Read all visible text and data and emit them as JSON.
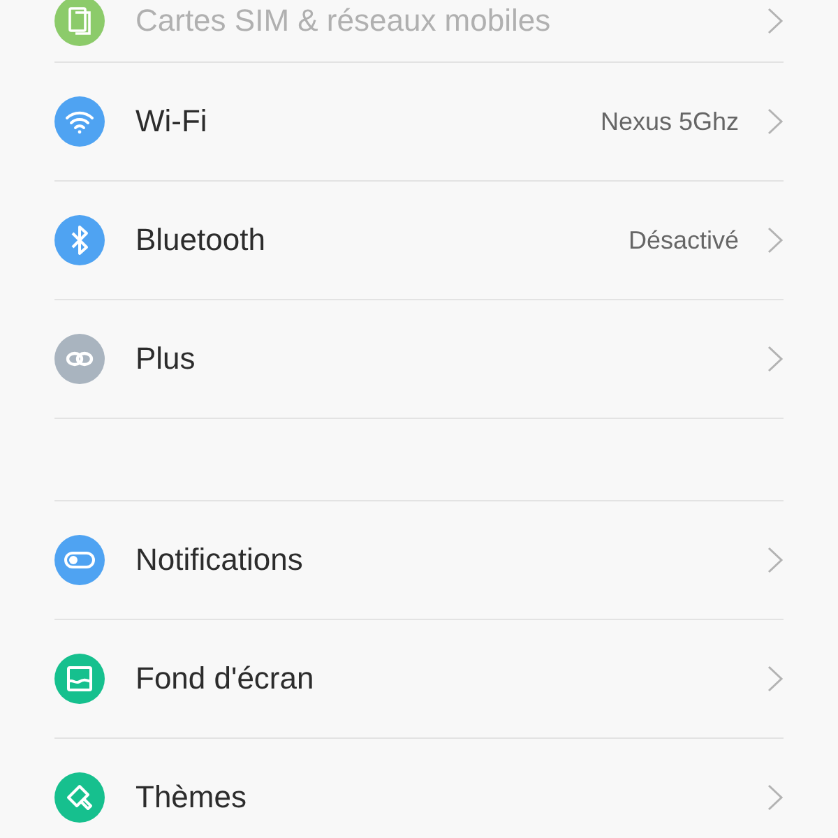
{
  "sections": [
    {
      "items": [
        {
          "color": "#8ccb6a",
          "label": "Cartes SIM & réseaux mobiles",
          "disabled": true
        },
        {
          "color": "#4fa3f2",
          "label": "Wi-Fi",
          "value": "Nexus 5Ghz",
          "disabled": false
        },
        {
          "color": "#4fa3f2",
          "label": "Bluetooth",
          "value": "Désactivé",
          "disabled": false
        },
        {
          "color": "#a9b4bf",
          "label": "Plus",
          "disabled": false
        }
      ]
    },
    {
      "items": [
        {
          "color": "#4fa3f2",
          "label": "Notifications",
          "disabled": false
        },
        {
          "color": "#16c08e",
          "label": "Fond d'écran",
          "disabled": false
        },
        {
          "color": "#16c08e",
          "label": "Thèmes",
          "disabled": false
        }
      ]
    }
  ]
}
